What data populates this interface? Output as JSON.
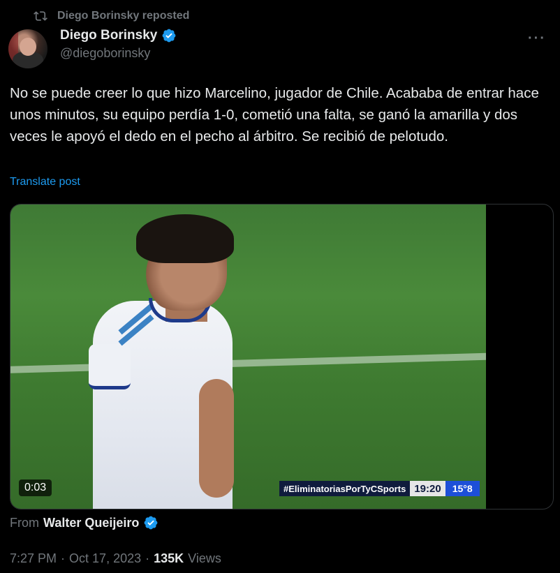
{
  "repost": {
    "label": "Diego Borinsky reposted"
  },
  "author": {
    "display_name": "Diego Borinsky",
    "handle": "@diegoborinsky",
    "verified": true
  },
  "more_label": "···",
  "tweet": {
    "text": "No se puede creer lo que hizo Marcelino, jugador de Chile. Acababa de entrar hace unos minutos, su equipo perdía 1-0, cometió una falta, se ganó la amarilla y dos veces le apoyó el dedo en el pecho al árbitro. Se recibió de pelotudo.",
    "translate_label": "Translate post"
  },
  "media": {
    "duration": "0:03",
    "scorebar": {
      "hashtag": "#EliminatoriasPorTyCSports",
      "clock": "19:20",
      "minute": "15°8"
    }
  },
  "attribution": {
    "from_label": "From",
    "source_name": "Walter Queijeiro",
    "verified": true
  },
  "meta": {
    "time": "7:27 PM",
    "separator": "·",
    "date": "Oct 17, 2023",
    "views_count": "135K",
    "views_label": "Views"
  },
  "colors": {
    "accent": "#1d9bf0",
    "muted": "#71767b",
    "text": "#e7e9ea",
    "background": "#000000"
  }
}
